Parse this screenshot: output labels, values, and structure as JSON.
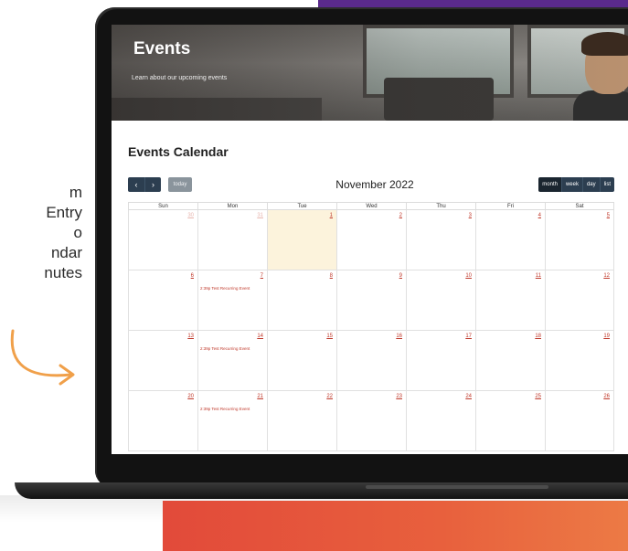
{
  "side_text": [
    "m",
    "Entry",
    "o",
    "ndar",
    "nutes"
  ],
  "hero": {
    "title": "Events",
    "subtitle": "Learn about our upcoming events"
  },
  "calendar": {
    "heading": "Events Calendar",
    "month_title": "November 2022",
    "nav": {
      "prev": "‹",
      "next": "›",
      "today": "today"
    },
    "views": [
      "month",
      "week",
      "day",
      "list"
    ],
    "active_view": "month",
    "weekdays": [
      "Sun",
      "Mon",
      "Tue",
      "Wed",
      "Thu",
      "Fri",
      "Sat"
    ],
    "weeks": [
      [
        {
          "day": "30",
          "other": true,
          "event": ""
        },
        {
          "day": "31",
          "other": true,
          "event": ""
        },
        {
          "day": "1",
          "other": false,
          "today": true,
          "event": ""
        },
        {
          "day": "2",
          "other": false,
          "event": ""
        },
        {
          "day": "3",
          "other": false,
          "event": ""
        },
        {
          "day": "4",
          "other": false,
          "event": ""
        },
        {
          "day": "5",
          "other": false,
          "event": ""
        }
      ],
      [
        {
          "day": "6",
          "other": false,
          "event": ""
        },
        {
          "day": "7",
          "other": false,
          "event": "2:39p Test Recurring Event"
        },
        {
          "day": "8",
          "other": false,
          "event": ""
        },
        {
          "day": "9",
          "other": false,
          "event": ""
        },
        {
          "day": "10",
          "other": false,
          "event": ""
        },
        {
          "day": "11",
          "other": false,
          "event": ""
        },
        {
          "day": "12",
          "other": false,
          "event": ""
        }
      ],
      [
        {
          "day": "13",
          "other": false,
          "event": ""
        },
        {
          "day": "14",
          "other": false,
          "event": "2:39p Test Recurring Event"
        },
        {
          "day": "15",
          "other": false,
          "event": ""
        },
        {
          "day": "16",
          "other": false,
          "event": ""
        },
        {
          "day": "17",
          "other": false,
          "event": ""
        },
        {
          "day": "18",
          "other": false,
          "event": ""
        },
        {
          "day": "19",
          "other": false,
          "event": ""
        }
      ],
      [
        {
          "day": "20",
          "other": false,
          "event": ""
        },
        {
          "day": "21",
          "other": false,
          "event": "2:39p Test Recurring Event"
        },
        {
          "day": "22",
          "other": false,
          "event": ""
        },
        {
          "day": "23",
          "other": false,
          "event": ""
        },
        {
          "day": "24",
          "other": false,
          "event": ""
        },
        {
          "day": "25",
          "other": false,
          "event": ""
        },
        {
          "day": "26",
          "other": false,
          "event": ""
        }
      ]
    ]
  },
  "colors": {
    "nav_button": "#2c3e50",
    "today_highlight": "#fcf3dc",
    "day_number": "#c0392b",
    "accent_orange": "#e8603d",
    "purple": "#5a2a8c"
  }
}
